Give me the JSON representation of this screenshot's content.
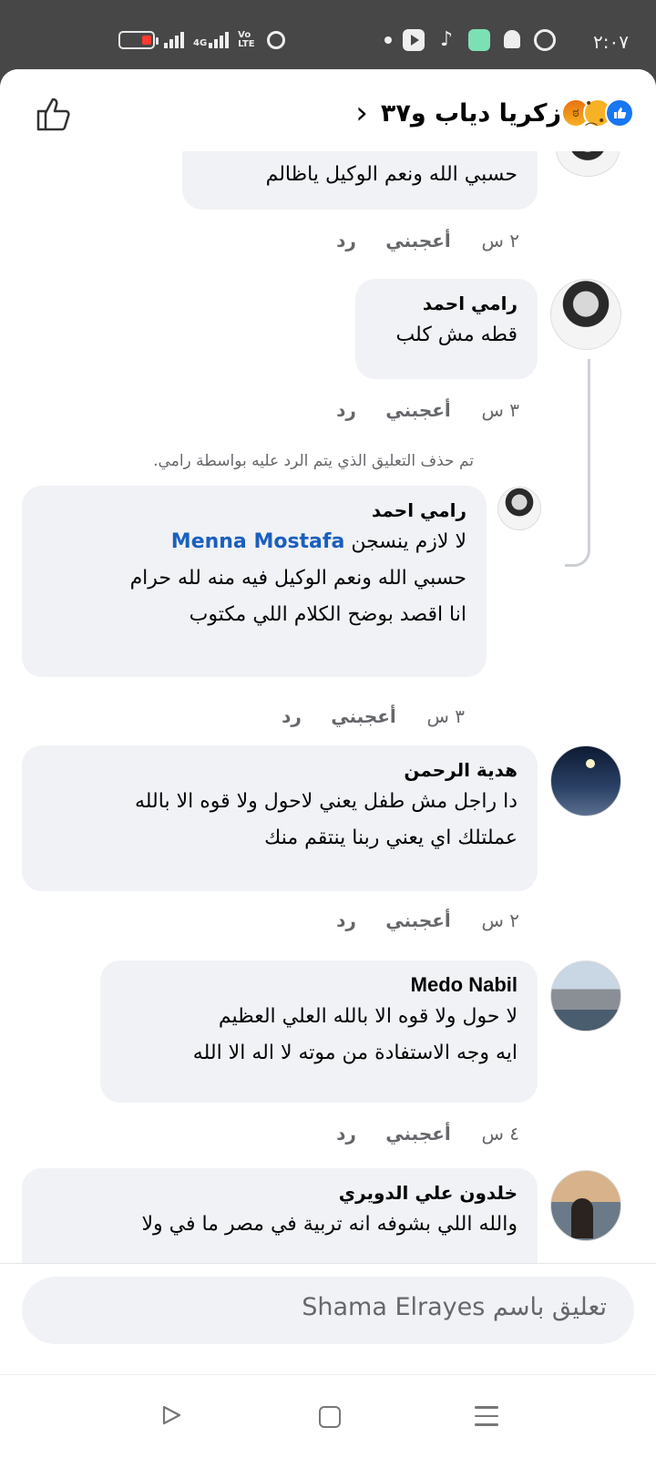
{
  "status_bar": {
    "time": "٢:٠٧",
    "signal_label_1": "4G",
    "signal_label_2": "Vo\nLTE",
    "icons": [
      "battery-low-icon",
      "signal-icon",
      "4g-signal-icon",
      "volte-icon",
      "alarm-icon",
      "dot-icon",
      "youtube-icon",
      "tiktok-icon",
      "app-green-icon",
      "snapchat-icon",
      "whatsapp-icon"
    ]
  },
  "header": {
    "title": "زكريا دياب و٣٧",
    "reactions": [
      "like",
      "sad",
      "angry"
    ],
    "back_icon": "chevron-left-icon",
    "like_icon": "thumbs-up-outline-icon"
  },
  "comments": [
    {
      "name": "",
      "lines": [
        "حسبي الله ونعم الوكيل ياظالم"
      ],
      "time": "٢ س",
      "like_label": "أعجبني",
      "reply_label": "رد"
    },
    {
      "name": "رامي احمد",
      "lines": [
        "قطه مش كلب"
      ],
      "time": "٣ س",
      "like_label": "أعجبني",
      "reply_label": "رد"
    },
    {
      "deleted_note": "تم حذف التعليق الذي يتم الرد عليه بواسطة رامي.",
      "name": "رامي احمد",
      "mention": "Menna Mostafa",
      "first_line_prefix": "لا لازم ينسجن",
      "lines": [
        "حسبي الله ونعم الوكيل فيه منه لله حرام",
        "انا اقصد بوضح الكلام اللي مكتوب"
      ],
      "time": "٣ س",
      "like_label": "أعجبني",
      "reply_label": "رد"
    },
    {
      "name": "هدية الرحمن",
      "lines": [
        "دا راجل مش طفل يعني لاحول ولا قوه الا بالله",
        "عملتلك اي يعني ربنا ينتقم منك"
      ],
      "time": "٢ س",
      "like_label": "أعجبني",
      "reply_label": "رد"
    },
    {
      "name": "Medo Nabil",
      "lines": [
        "لا حول ولا قوه الا بالله العلي العظيم",
        "ايه وجه الاستفادة من موته لا اله الا الله"
      ],
      "time": "٤ س",
      "like_label": "أعجبني",
      "reply_label": "رد"
    },
    {
      "name": "خلدون علي الدويري",
      "lines": [
        "والله اللي بشوفه انه تربية في مصر ما في ولا"
      ]
    }
  ],
  "composer": {
    "placeholder": "تعليق باسم Shama Elrayes"
  },
  "nav": {
    "icons": [
      "back-triangle-icon",
      "home-square-icon",
      "recents-menu-icon"
    ]
  }
}
